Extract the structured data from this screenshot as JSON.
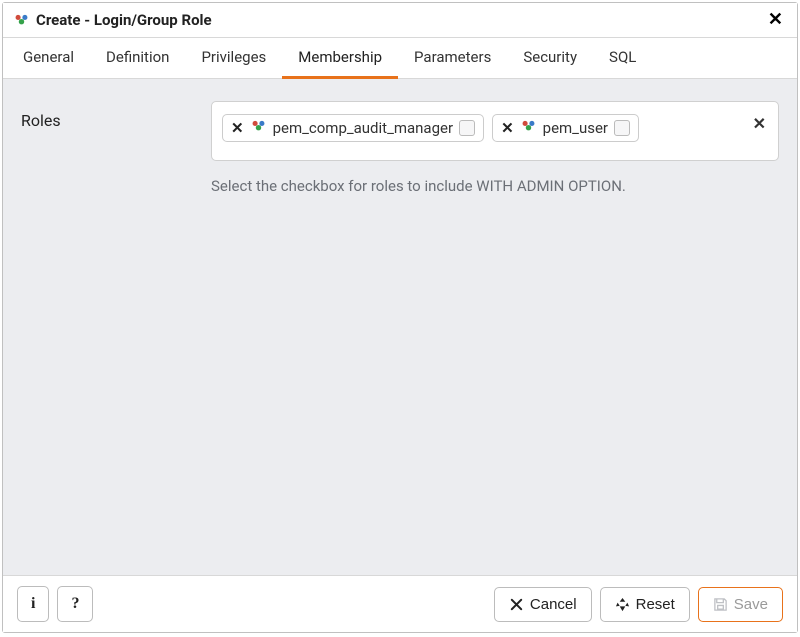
{
  "dialog": {
    "title": "Create - Login/Group Role"
  },
  "tabs": [
    {
      "label": "General",
      "active": false
    },
    {
      "label": "Definition",
      "active": false
    },
    {
      "label": "Privileges",
      "active": false
    },
    {
      "label": "Membership",
      "active": true
    },
    {
      "label": "Parameters",
      "active": false
    },
    {
      "label": "Security",
      "active": false
    },
    {
      "label": "SQL",
      "active": false
    }
  ],
  "form": {
    "roles_label": "Roles",
    "roles": [
      {
        "name": "pem_comp_audit_manager",
        "admin": false
      },
      {
        "name": "pem_user",
        "admin": false
      }
    ],
    "help_text": "Select the checkbox for roles to include WITH ADMIN OPTION."
  },
  "footer": {
    "info": "i",
    "help": "?",
    "cancel_label": "Cancel",
    "reset_label": "Reset",
    "save_label": "Save"
  }
}
